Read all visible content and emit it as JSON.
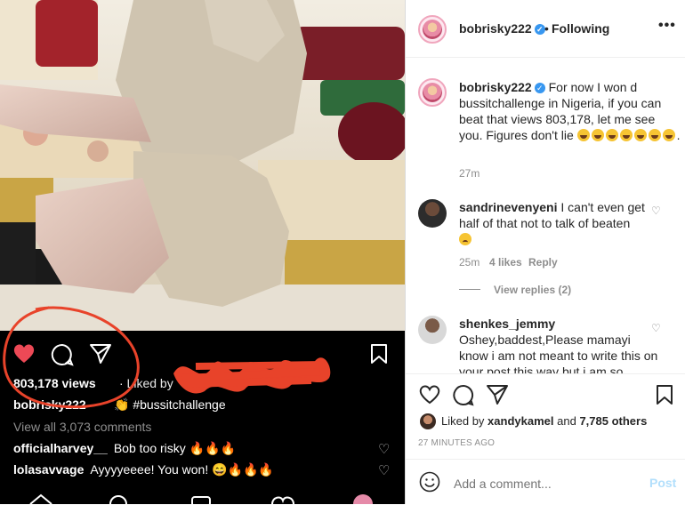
{
  "media": {
    "views": "803,178 views",
    "liked_by_prefix": "· Liked by",
    "caption_user": "bobrisky222",
    "caption_text": "👏 #bussitchallenge",
    "view_all": "View all 3,073 comments",
    "comments": [
      {
        "user": "officialharvey__",
        "text": "Bob too risky 🔥🔥🔥"
      },
      {
        "user": "lolasavvage",
        "text": "Ayyyyeeee! You won! 😄🔥🔥🔥"
      }
    ]
  },
  "post": {
    "username": "bobrisky222",
    "separator": "•",
    "follow_status": "Following",
    "more": "•••",
    "caption": {
      "user": "bobrisky222",
      "text": "For now I won d bussitchallenge in Nigeria, if you can beat that views 803,178, let me see you. Figures don't lie",
      "end": ".",
      "time": "27m"
    },
    "comments": [
      {
        "user": "sandrinevenyeni",
        "text": "I can't even get half of that not to talk of beaten",
        "time": "25m",
        "likes": "4 likes",
        "reply": "Reply",
        "view_replies": "View replies (2)"
      },
      {
        "user": "shenkes_jemmy",
        "text": "Oshey,baddest,Please mamayi know i am not meant to write this on your post this way but i am so"
      }
    ],
    "liked_by": {
      "prefix": "Liked by",
      "user": "xandykamel",
      "and": "and",
      "others": "7,785 others"
    },
    "timestamp": "27 MINUTES AGO",
    "comment_placeholder": "Add a comment...",
    "post_button": "Post"
  },
  "colors": {
    "accent": "#3897f0",
    "heart": "#ed4956",
    "annotation": "#e8432a"
  }
}
